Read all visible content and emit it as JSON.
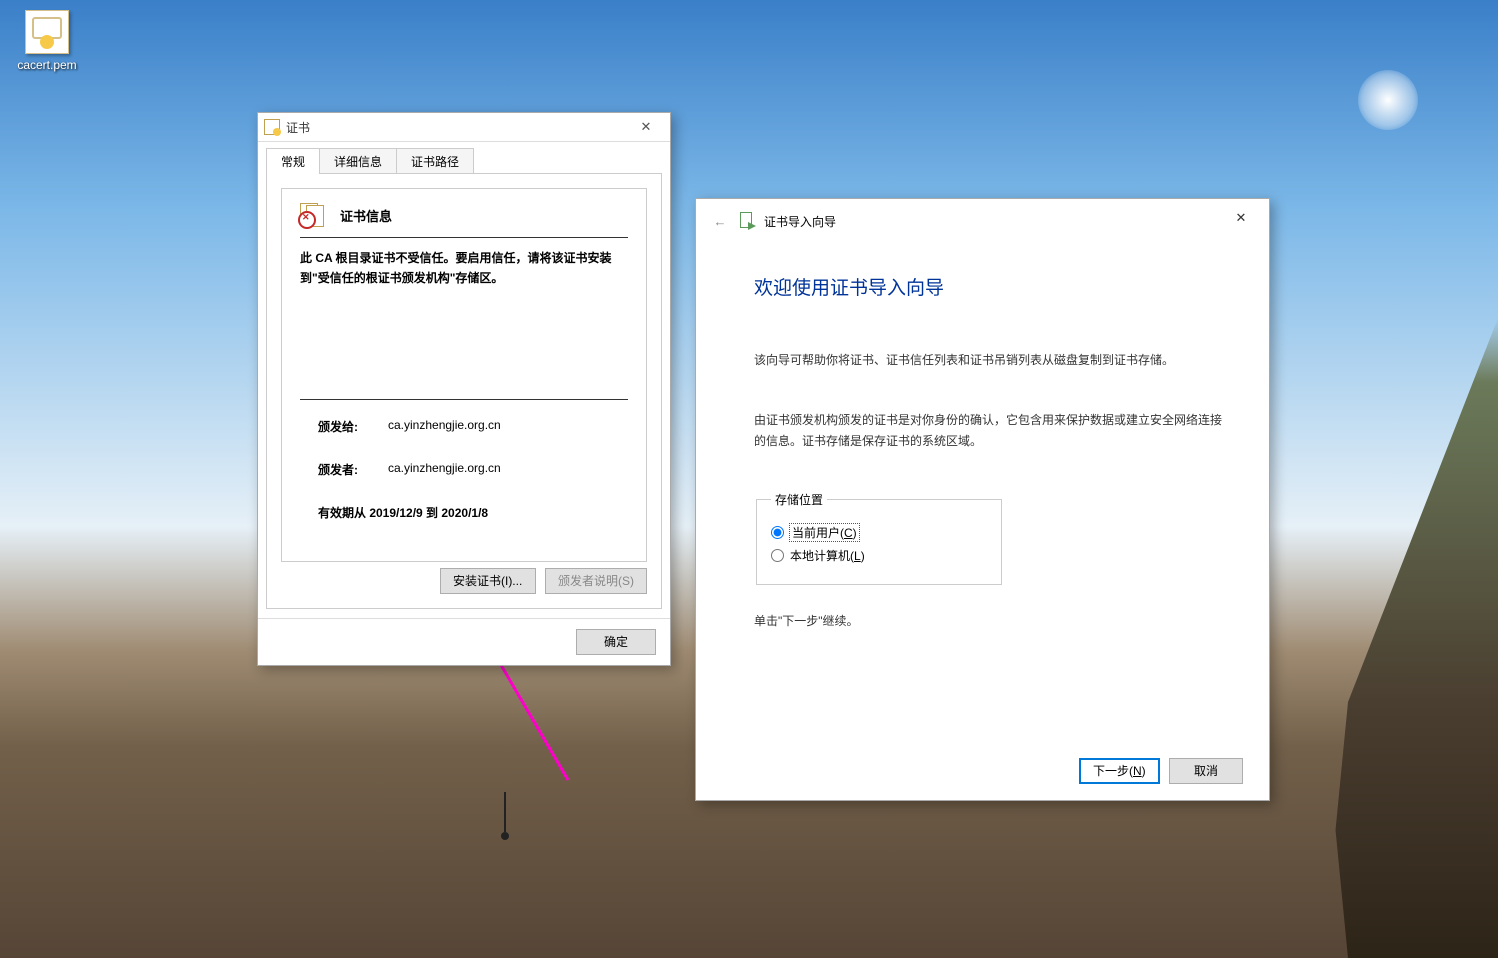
{
  "desktop": {
    "icon_label": "cacert.pem"
  },
  "cert_dialog": {
    "title": "证书",
    "tabs": {
      "general": "常规",
      "details": "详细信息",
      "path": "证书路径"
    },
    "info_head": "证书信息",
    "trust_warning": "此 CA 根目录证书不受信任。要启用信任，请将该证书安装到\"受信任的根证书颁发机构\"存储区。",
    "issued_to_label": "颁发给:",
    "issued_to_value": "ca.yinzhengjie.org.cn",
    "issuer_label": "颁发者:",
    "issuer_value": "ca.yinzhengjie.org.cn",
    "validity_text": "有效期从  2019/12/9  到  2020/1/8",
    "install_btn": "安装证书(I)...",
    "issuer_stmt_btn": "颁发者说明(S)",
    "ok_btn": "确定"
  },
  "wizard": {
    "window_title": "证书导入向导",
    "heading": "欢迎使用证书导入向导",
    "para1": "该向导可帮助你将证书、证书信任列表和证书吊销列表从磁盘复制到证书存储。",
    "para2": "由证书颁发机构颁发的证书是对你身份的确认，它包含用来保护数据或建立安全网络连接的信息。证书存储是保存证书的系统区域。",
    "store_legend": "存储位置",
    "radio1_label": "当前用户(",
    "radio1_letter": "C",
    "radio1_suffix": ")",
    "radio2_label": "本地计算机(",
    "radio2_letter": "L",
    "radio2_suffix": ")",
    "continue_text": "单击\"下一步\"继续。",
    "next_btn": "下一步(",
    "next_letter": "N",
    "next_suffix": ")",
    "cancel_btn": "取消"
  }
}
